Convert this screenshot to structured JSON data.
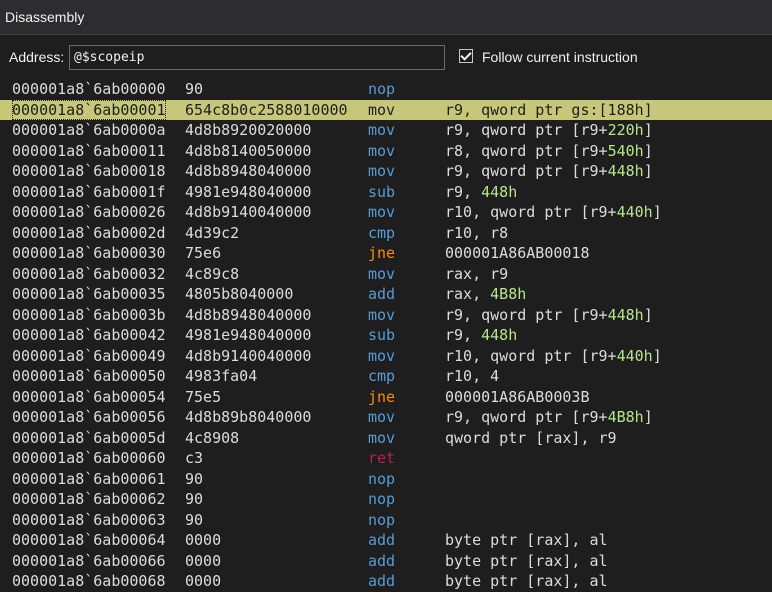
{
  "window": {
    "title": "Disassembly"
  },
  "toolbar": {
    "address_label": "Address:",
    "address_value": "@$scopeip",
    "follow_label": "Follow current instruction",
    "follow_checked": true
  },
  "colors": {
    "mnemonic": "#569cd6",
    "branch": "#ff8c00",
    "ret": "#c3185e",
    "number": "#b5e88a",
    "highlight": "#c7c77a"
  },
  "rows": [
    {
      "addr": "000001a8`6ab00000",
      "bytes": "90",
      "mnemonic": "nop",
      "operands": []
    },
    {
      "addr": "000001a8`6ab00001",
      "bytes": "654c8b0c2588010000",
      "mnemonic": "mov",
      "operands": [
        {
          "t": "r9, qword ptr gs:[188h]"
        }
      ],
      "current": true
    },
    {
      "addr": "000001a8`6ab0000a",
      "bytes": "4d8b8920020000",
      "mnemonic": "mov",
      "operands": [
        {
          "t": "r9, qword ptr [r9+"
        },
        {
          "t": "220h",
          "n": true
        },
        {
          "t": "]"
        }
      ]
    },
    {
      "addr": "000001a8`6ab00011",
      "bytes": "4d8b8140050000",
      "mnemonic": "mov",
      "operands": [
        {
          "t": "r8, qword ptr [r9+"
        },
        {
          "t": "540h",
          "n": true
        },
        {
          "t": "]"
        }
      ]
    },
    {
      "addr": "000001a8`6ab00018",
      "bytes": "4d8b8948040000",
      "mnemonic": "mov",
      "operands": [
        {
          "t": "r9, qword ptr [r9+"
        },
        {
          "t": "448h",
          "n": true
        },
        {
          "t": "]"
        }
      ]
    },
    {
      "addr": "000001a8`6ab0001f",
      "bytes": "4981e948040000",
      "mnemonic": "sub",
      "operands": [
        {
          "t": "r9, "
        },
        {
          "t": "448h",
          "n": true
        }
      ]
    },
    {
      "addr": "000001a8`6ab00026",
      "bytes": "4d8b9140040000",
      "mnemonic": "mov",
      "operands": [
        {
          "t": "r10, qword ptr [r9+"
        },
        {
          "t": "440h",
          "n": true
        },
        {
          "t": "]"
        }
      ]
    },
    {
      "addr": "000001a8`6ab0002d",
      "bytes": "4d39c2",
      "mnemonic": "cmp",
      "operands": [
        {
          "t": "r10, r8"
        }
      ]
    },
    {
      "addr": "000001a8`6ab00030",
      "bytes": "75e6",
      "mnemonic": "jne",
      "operands": [
        {
          "t": "000001A86AB00018"
        }
      ],
      "kind": "branch"
    },
    {
      "addr": "000001a8`6ab00032",
      "bytes": "4c89c8",
      "mnemonic": "mov",
      "operands": [
        {
          "t": "rax, r9"
        }
      ]
    },
    {
      "addr": "000001a8`6ab00035",
      "bytes": "4805b8040000",
      "mnemonic": "add",
      "operands": [
        {
          "t": "rax, "
        },
        {
          "t": "4B8h",
          "n": true
        }
      ]
    },
    {
      "addr": "000001a8`6ab0003b",
      "bytes": "4d8b8948040000",
      "mnemonic": "mov",
      "operands": [
        {
          "t": "r9, qword ptr [r9+"
        },
        {
          "t": "448h",
          "n": true
        },
        {
          "t": "]"
        }
      ]
    },
    {
      "addr": "000001a8`6ab00042",
      "bytes": "4981e948040000",
      "mnemonic": "sub",
      "operands": [
        {
          "t": "r9, "
        },
        {
          "t": "448h",
          "n": true
        }
      ]
    },
    {
      "addr": "000001a8`6ab00049",
      "bytes": "4d8b9140040000",
      "mnemonic": "mov",
      "operands": [
        {
          "t": "r10, qword ptr [r9+"
        },
        {
          "t": "440h",
          "n": true
        },
        {
          "t": "]"
        }
      ]
    },
    {
      "addr": "000001a8`6ab00050",
      "bytes": "4983fa04",
      "mnemonic": "cmp",
      "operands": [
        {
          "t": "r10, 4"
        }
      ]
    },
    {
      "addr": "000001a8`6ab00054",
      "bytes": "75e5",
      "mnemonic": "jne",
      "operands": [
        {
          "t": "000001A86AB0003B"
        }
      ],
      "kind": "branch"
    },
    {
      "addr": "000001a8`6ab00056",
      "bytes": "4d8b89b8040000",
      "mnemonic": "mov",
      "operands": [
        {
          "t": "r9, qword ptr [r9+"
        },
        {
          "t": "4B8h",
          "n": true
        },
        {
          "t": "]"
        }
      ]
    },
    {
      "addr": "000001a8`6ab0005d",
      "bytes": "4c8908",
      "mnemonic": "mov",
      "operands": [
        {
          "t": "qword ptr [rax], r9"
        }
      ]
    },
    {
      "addr": "000001a8`6ab00060",
      "bytes": "c3",
      "mnemonic": "ret",
      "operands": [],
      "kind": "ret"
    },
    {
      "addr": "000001a8`6ab00061",
      "bytes": "90",
      "mnemonic": "nop",
      "operands": []
    },
    {
      "addr": "000001a8`6ab00062",
      "bytes": "90",
      "mnemonic": "nop",
      "operands": []
    },
    {
      "addr": "000001a8`6ab00063",
      "bytes": "90",
      "mnemonic": "nop",
      "operands": []
    },
    {
      "addr": "000001a8`6ab00064",
      "bytes": "0000",
      "mnemonic": "add",
      "operands": [
        {
          "t": "byte ptr [rax], al"
        }
      ]
    },
    {
      "addr": "000001a8`6ab00066",
      "bytes": "0000",
      "mnemonic": "add",
      "operands": [
        {
          "t": "byte ptr [rax], al"
        }
      ]
    },
    {
      "addr": "000001a8`6ab00068",
      "bytes": "0000",
      "mnemonic": "add",
      "operands": [
        {
          "t": "byte ptr [rax], al"
        }
      ]
    }
  ]
}
